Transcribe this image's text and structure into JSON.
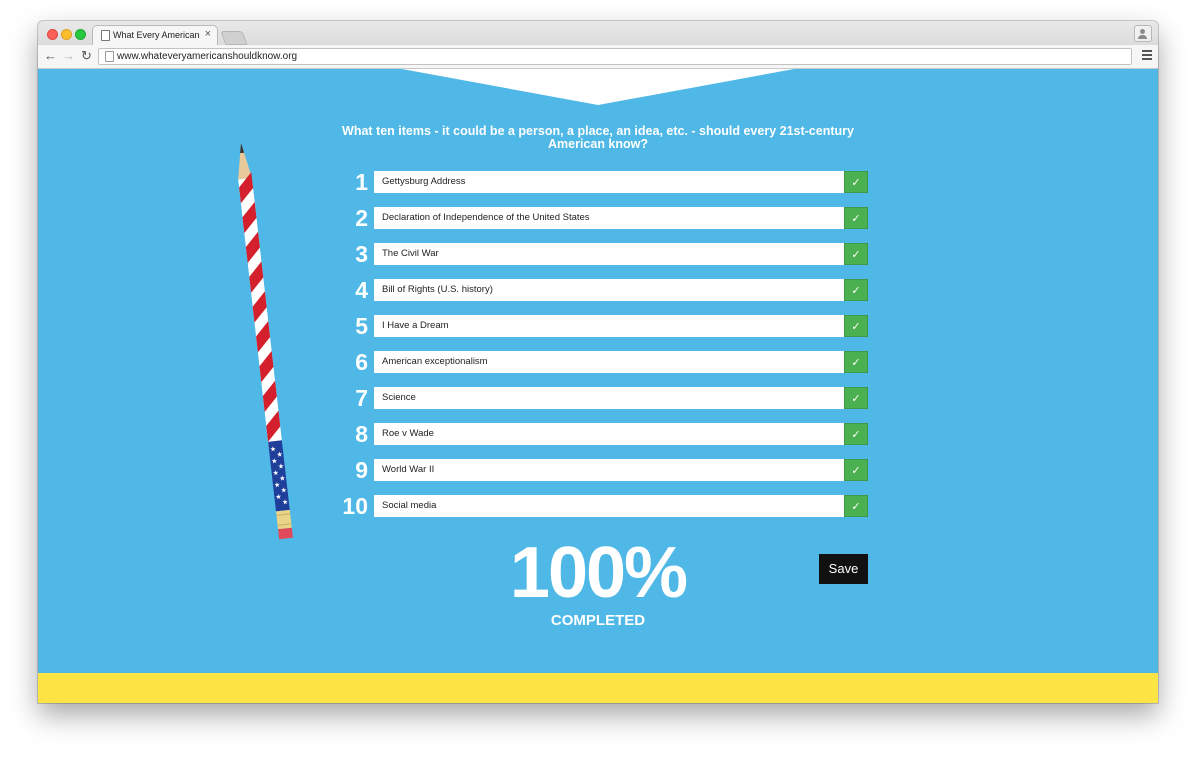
{
  "browser": {
    "tab_title": "What Every American Shou",
    "tab_close": "×",
    "url": "www.whateveryamericanshouldknow.org",
    "back_icon": "back-arrow-icon",
    "forward_icon": "forward-arrow-icon",
    "reload_icon": "reload-icon"
  },
  "page": {
    "question": "What ten items - it could be a person, a place, an idea, etc. - should every 21st-century American know?",
    "items": [
      {
        "number": "1",
        "value": "Gettysburg Address"
      },
      {
        "number": "2",
        "value": "Declaration of Independence of the United States"
      },
      {
        "number": "3",
        "value": "The Civil War"
      },
      {
        "number": "4",
        "value": "Bill of Rights (U.S. history)"
      },
      {
        "number": "5",
        "value": "I Have a Dream"
      },
      {
        "number": "6",
        "value": "American exceptionalism"
      },
      {
        "number": "7",
        "value": "Science"
      },
      {
        "number": "8",
        "value": "Roe v Wade"
      },
      {
        "number": "9",
        "value": "World War II"
      },
      {
        "number": "10",
        "value": "Social media"
      }
    ],
    "check_mark": "✓",
    "progress_percent": "100%",
    "progress_label": "COMPLETED",
    "save_label": "Save"
  },
  "colors": {
    "background": "#4fb8e7",
    "check_green": "#4bb04f",
    "footer_yellow": "#fde445",
    "save_button": "#111111"
  }
}
